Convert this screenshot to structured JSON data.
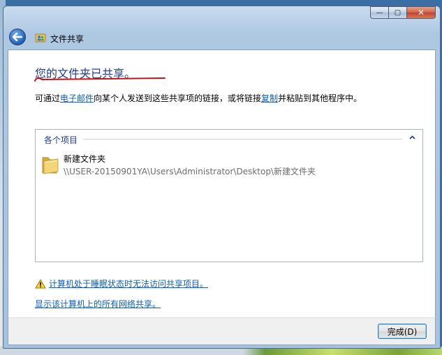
{
  "window": {
    "title": "文件共享",
    "caption": {
      "minimize": "—",
      "maximize": "▢",
      "close": "✕"
    }
  },
  "main": {
    "headline": "您的文件夹已共享。",
    "desc_prefix": "可通过",
    "desc_email_link": "电子邮件",
    "desc_middle": "向某个人发送到这些共享项的链接，或将链接",
    "desc_copy_link": "复制",
    "desc_suffix": "并粘贴到其他程序中。",
    "group_header": "各个项目",
    "items": [
      {
        "name": "新建文件夹",
        "path": "\\\\USER-20150901YA\\Users\\Administrator\\Desktop\\新建文件夹"
      }
    ],
    "warning_link": "计算机处于睡眠状态时无法访问共享项目。",
    "show_all_link": "显示该计算机上的所有网络共享。"
  },
  "footer": {
    "done_label": "完成(D)"
  },
  "colors": {
    "headline": "#1f3c8c",
    "link": "#0d5fb2",
    "underline_red": "#cc1111"
  }
}
